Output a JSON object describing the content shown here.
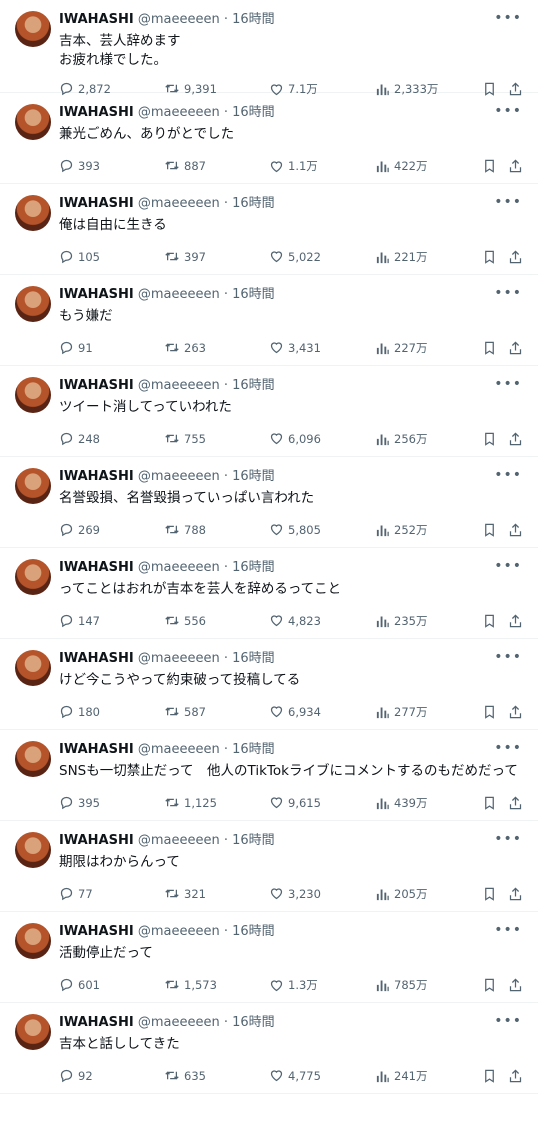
{
  "tweets": [
    {
      "name": "IWAHASHI",
      "handle": "@maeeeeen",
      "time": "16時間",
      "text": "吉本、芸人辞めます\nお疲れ様でした。",
      "replies": "2,872",
      "retweets": "9,391",
      "likes": "7.1万",
      "views": "2,333万"
    },
    {
      "name": "IWAHASHI",
      "handle": "@maeeeeen",
      "time": "16時間",
      "text": "兼光ごめん、ありがとでした",
      "replies": "393",
      "retweets": "887",
      "likes": "1.1万",
      "views": "422万"
    },
    {
      "name": "IWAHASHI",
      "handle": "@maeeeeen",
      "time": "16時間",
      "text": "俺は自由に生きる",
      "replies": "105",
      "retweets": "397",
      "likes": "5,022",
      "views": "221万"
    },
    {
      "name": "IWAHASHI",
      "handle": "@maeeeeen",
      "time": "16時間",
      "text": "もう嫌だ",
      "replies": "91",
      "retweets": "263",
      "likes": "3,431",
      "views": "227万"
    },
    {
      "name": "IWAHASHI",
      "handle": "@maeeeeen",
      "time": "16時間",
      "text": "ツイート消してっていわれた",
      "replies": "248",
      "retweets": "755",
      "likes": "6,096",
      "views": "256万"
    },
    {
      "name": "IWAHASHI",
      "handle": "@maeeeeen",
      "time": "16時間",
      "text": "名誉毀損、名誉毀損っていっぱい言われた",
      "replies": "269",
      "retweets": "788",
      "likes": "5,805",
      "views": "252万"
    },
    {
      "name": "IWAHASHI",
      "handle": "@maeeeeen",
      "time": "16時間",
      "text": "ってことはおれが吉本を芸人を辞めるってこと",
      "replies": "147",
      "retweets": "556",
      "likes": "4,823",
      "views": "235万"
    },
    {
      "name": "IWAHASHI",
      "handle": "@maeeeeen",
      "time": "16時間",
      "text": "けど今こうやって約束破って投稿してる",
      "replies": "180",
      "retweets": "587",
      "likes": "6,934",
      "views": "277万"
    },
    {
      "name": "IWAHASHI",
      "handle": "@maeeeeen",
      "time": "16時間",
      "text": "SNSも一切禁止だって　他人のTikTokライブにコメントするのもだめだって",
      "replies": "395",
      "retweets": "1,125",
      "likes": "9,615",
      "views": "439万"
    },
    {
      "name": "IWAHASHI",
      "handle": "@maeeeeen",
      "time": "16時間",
      "text": "期限はわからんって",
      "replies": "77",
      "retweets": "321",
      "likes": "3,230",
      "views": "205万"
    },
    {
      "name": "IWAHASHI",
      "handle": "@maeeeeen",
      "time": "16時間",
      "text": "活動停止だって",
      "replies": "601",
      "retweets": "1,573",
      "likes": "1.3万",
      "views": "785万"
    },
    {
      "name": "IWAHASHI",
      "handle": "@maeeeeen",
      "time": "16時間",
      "text": "吉本と話ししてきた",
      "replies": "92",
      "retweets": "635",
      "likes": "4,775",
      "views": "241万"
    }
  ],
  "separator": "·",
  "icons": {
    "more": "more-icon",
    "reply": "reply-icon",
    "retweet": "retweet-icon",
    "like": "heart-icon",
    "views": "views-icon",
    "bookmark": "bookmark-icon",
    "share": "share-icon"
  }
}
